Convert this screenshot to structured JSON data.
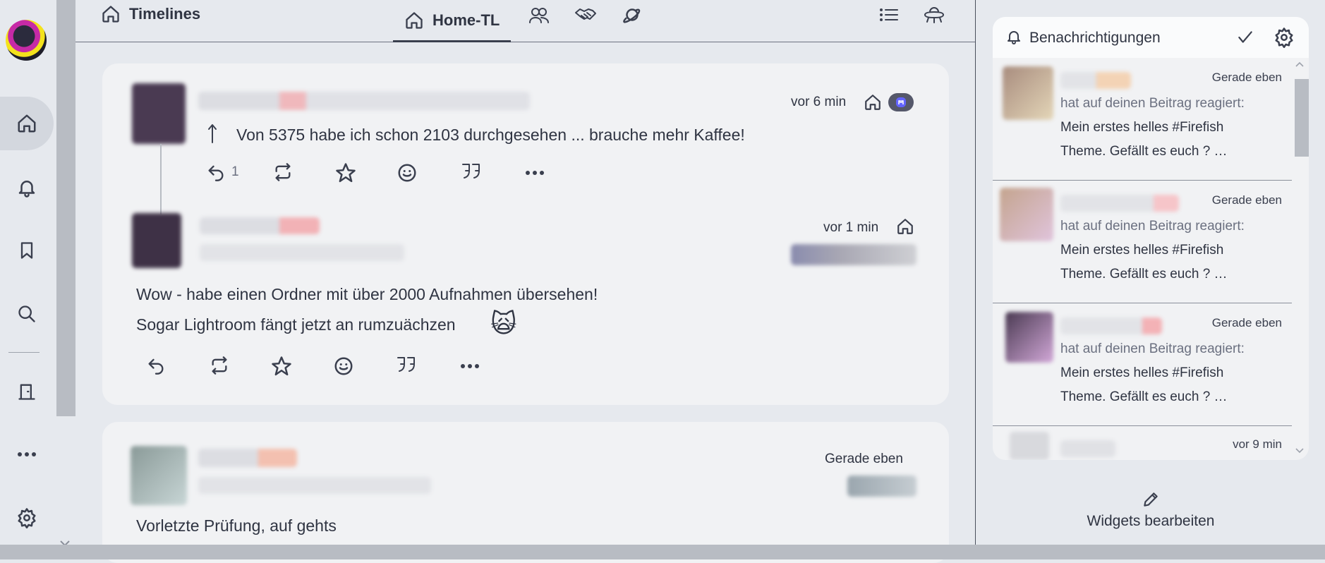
{
  "header": {
    "title": "Timelines",
    "active_tab": "Home-TL"
  },
  "posts": [
    {
      "time": "vor 6 min",
      "text": "Von 5375 habe ich schon 2103 durchgesehen ... brauche mehr Kaffee!",
      "reply_count": "1"
    },
    {
      "time": "vor 1 min",
      "text_line1": "Wow - habe einen Ordner mit über 2000 Aufnahmen übersehen!",
      "text_line2": "Sogar Lightroom fängt jetzt an rumzuächzen",
      "emoji": "🙀"
    },
    {
      "time": "Gerade eben",
      "text": "Vorletzte Prüfung, auf gehts"
    }
  ],
  "notifications": {
    "title": "Benachrichtigungen",
    "items": [
      {
        "time": "Gerade eben",
        "action": "hat auf deinen Beitrag reagiert:",
        "line1": "Mein erstes helles #Firefish",
        "line2": "Theme. Gefällt es euch ?  …"
      },
      {
        "time": "Gerade eben",
        "action": "hat auf deinen Beitrag reagiert:",
        "line1": "Mein erstes helles #Firefish",
        "line2": "Theme. Gefällt es euch ?  …"
      },
      {
        "time": "Gerade eben",
        "action": "hat auf deinen Beitrag reagiert:",
        "line1": "Mein erstes helles #Firefish",
        "line2": "Theme. Gefällt es euch ?  …"
      },
      {
        "time": "vor 9 min"
      }
    ]
  },
  "widgets_button": "Widgets bearbeiten",
  "colors": {
    "background": "#e6e9ee",
    "card": "#f1f2f4",
    "text": "#2f3442",
    "muted": "#6b7080"
  }
}
